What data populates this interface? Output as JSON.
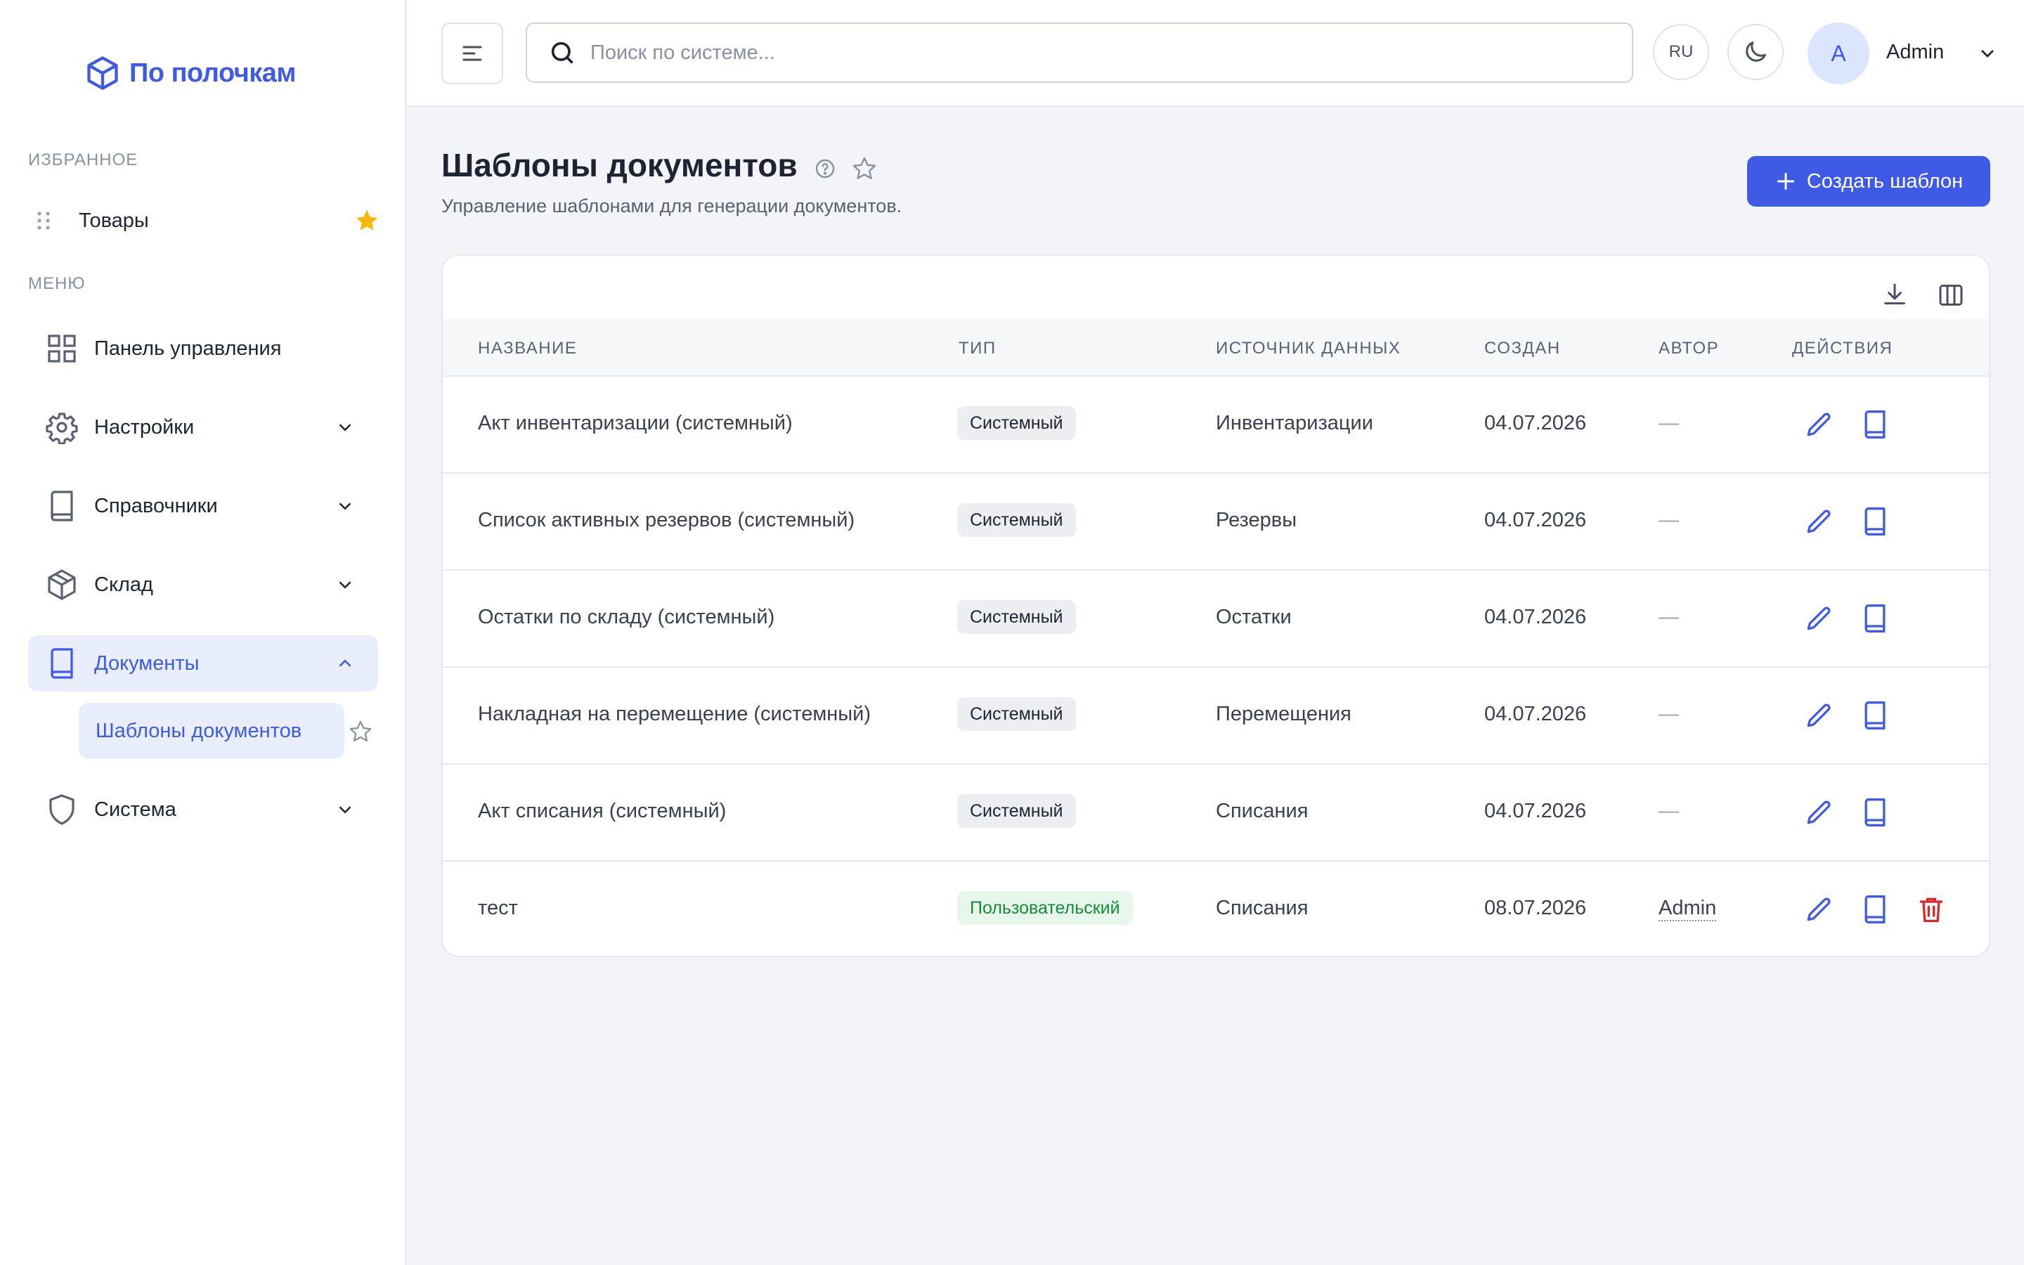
{
  "app": {
    "brand": "По полочкам"
  },
  "sidebar": {
    "favorites_label": "ИЗБРАННОЕ",
    "favorites": [
      {
        "label": "Товары"
      }
    ],
    "menu_label": "МЕНЮ",
    "items": [
      {
        "label": "Панель управления",
        "icon": "grid-icon",
        "expandable": false
      },
      {
        "label": "Настройки",
        "icon": "gear-icon",
        "expandable": true
      },
      {
        "label": "Справочники",
        "icon": "book-icon",
        "expandable": true
      },
      {
        "label": "Склад",
        "icon": "box-icon",
        "expandable": true
      },
      {
        "label": "Документы",
        "icon": "book-icon",
        "expandable": true,
        "active": true
      },
      {
        "label": "Система",
        "icon": "shield-icon",
        "expandable": true
      }
    ],
    "subitem": {
      "label": "Шаблоны документов"
    }
  },
  "topbar": {
    "search_placeholder": "Поиск по системе...",
    "lang": "RU",
    "avatar_letter": "A",
    "user_name": "Admin"
  },
  "page": {
    "title": "Шаблоны документов",
    "subtitle": "Управление шаблонами для генерации документов.",
    "create_label": "Создать шаблон"
  },
  "table": {
    "columns": [
      "НАЗВАНИЕ",
      "ТИП",
      "ИСТОЧНИК ДАННЫХ",
      "СОЗДАН",
      "АВТОР",
      "ДЕЙСТВИЯ"
    ],
    "rows": [
      {
        "name": "Акт инвентаризации (системный)",
        "type": "Системный",
        "source": "Инвентаризации",
        "created": "04.07.2026",
        "author": "—"
      },
      {
        "name": "Список активных резервов (системный)",
        "type": "Системный",
        "source": "Резервы",
        "created": "04.07.2026",
        "author": "—"
      },
      {
        "name": "Остатки по складу (системный)",
        "type": "Системный",
        "source": "Остатки",
        "created": "04.07.2026",
        "author": "—"
      },
      {
        "name": "Накладная на перемещение (системный)",
        "type": "Системный",
        "source": "Перемещения",
        "created": "04.07.2026",
        "author": "—"
      },
      {
        "name": "Акт списания (системный)",
        "type": "Системный",
        "source": "Списания",
        "created": "04.07.2026",
        "author": "—"
      },
      {
        "name": "тест",
        "type": "Пользовательский",
        "source": "Списания",
        "created": "08.07.2026",
        "author": "Admin"
      }
    ]
  },
  "colors": {
    "accent": "#3f5be6",
    "danger": "#dc2626",
    "star": "#f5b700",
    "success": "#178a3b"
  }
}
